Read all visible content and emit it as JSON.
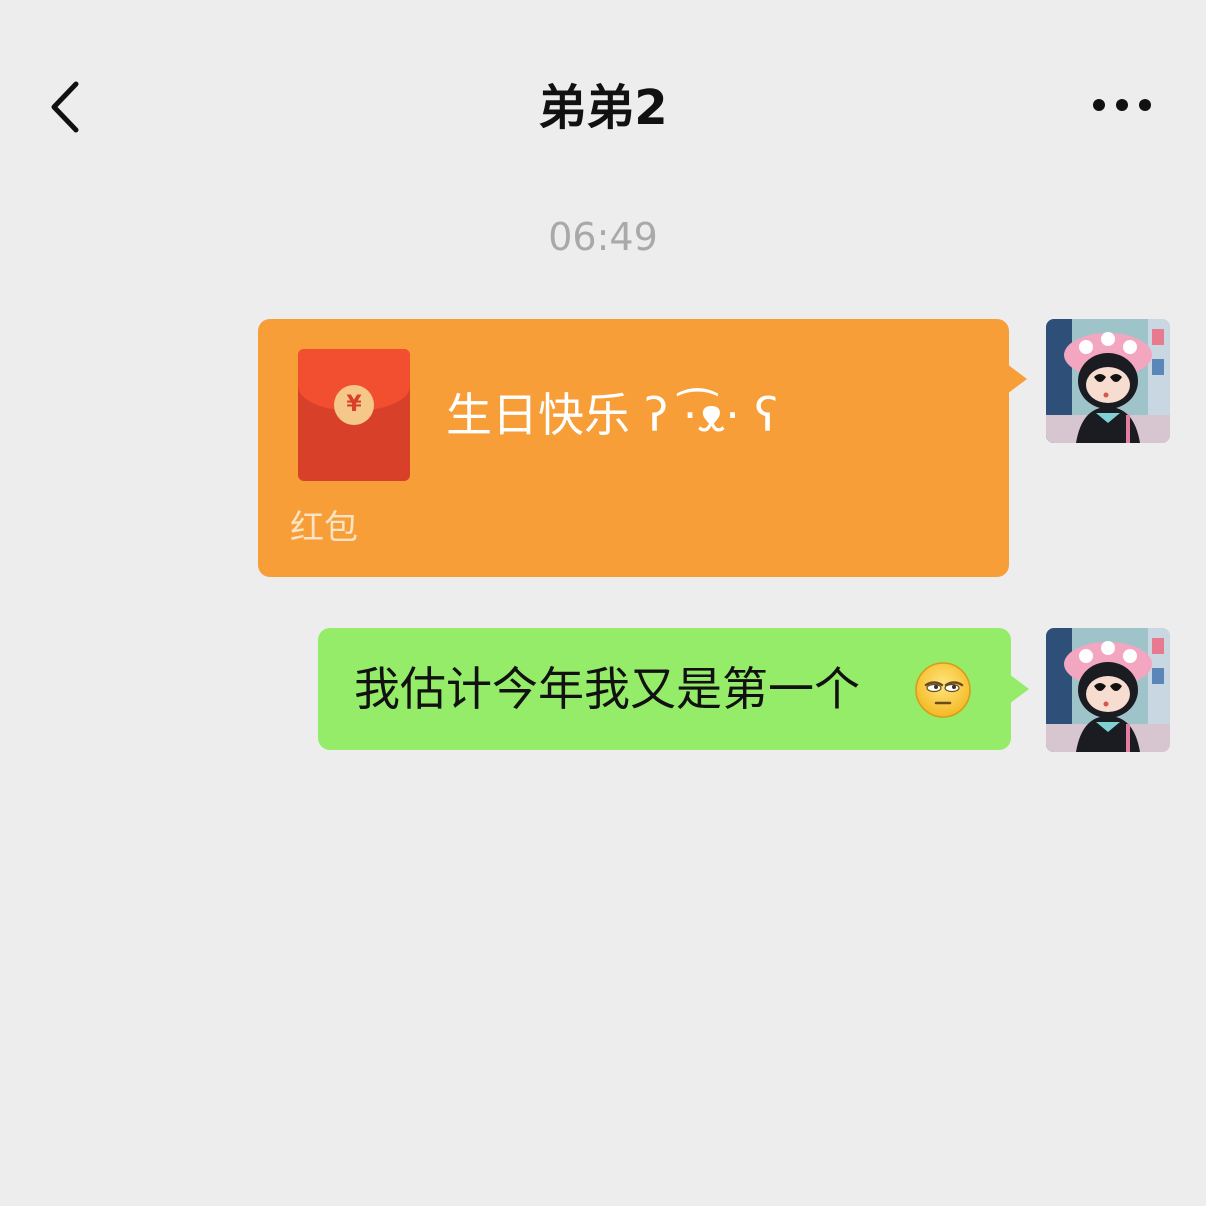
{
  "nav": {
    "back_icon": "chevron-left-icon",
    "title": "弟弟2",
    "more_icon": "more-dots-icon"
  },
  "chat": {
    "timestamp": "06:49",
    "messages": [
      {
        "type": "red-packet",
        "text": "生日快乐 ʔ ·͡ᴥ· ʕ",
        "label": "红包",
        "coin_symbol": "¥",
        "bubble_color": "#f79e39"
      },
      {
        "type": "text",
        "text": "我估计今年我又是第一个",
        "emoji": "unamused-face-icon",
        "bubble_color": "#95ec69"
      }
    ]
  },
  "colors": {
    "background": "#ededed",
    "timestamp": "#a9a9a9"
  }
}
